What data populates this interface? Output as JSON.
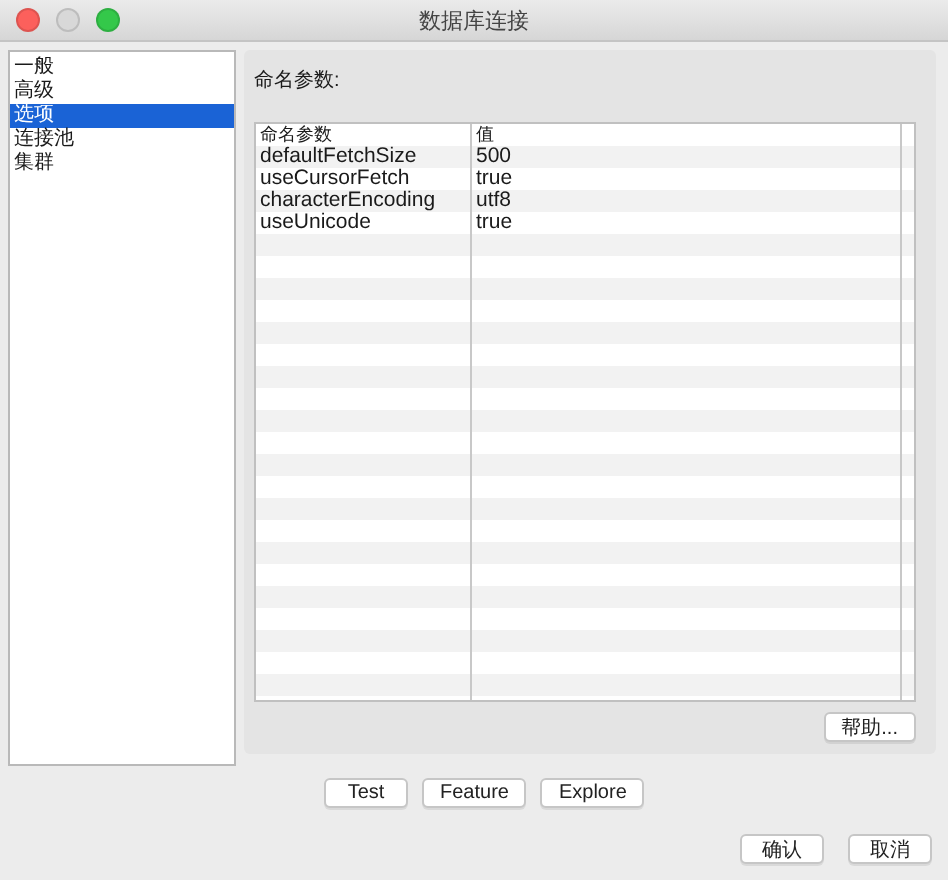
{
  "window": {
    "title": "数据库连接"
  },
  "sidebar": {
    "items": [
      {
        "label": "一般",
        "selected": false
      },
      {
        "label": "高级",
        "selected": false
      },
      {
        "label": "选项",
        "selected": true
      },
      {
        "label": "连接池",
        "selected": false
      },
      {
        "label": "集群",
        "selected": false
      }
    ]
  },
  "panel": {
    "heading": "命名参数:",
    "table": {
      "columns": [
        "命名参数",
        "值"
      ],
      "rows": [
        [
          "defaultFetchSize",
          "500"
        ],
        [
          "useCursorFetch",
          "true"
        ],
        [
          "characterEncoding",
          "utf8"
        ],
        [
          "useUnicode",
          "true"
        ]
      ]
    },
    "help_button": "帮助..."
  },
  "action_buttons": [
    "Test",
    "Feature",
    "Explore"
  ],
  "dialog_buttons": [
    "确认",
    "取消"
  ]
}
